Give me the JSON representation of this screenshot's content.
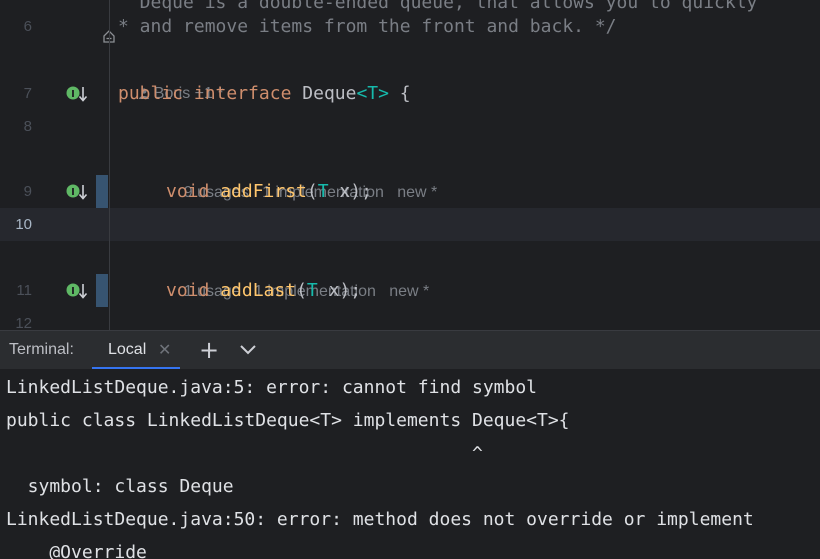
{
  "editor": {
    "lines": [
      {
        "num": "6",
        "text": "* and remove items from the front and back. */"
      },
      {
        "num": "7",
        "kw1": "public",
        "kw2": "interface",
        "name": "Deque",
        "generic": "<T>",
        "rest": " {"
      },
      {
        "num": "8"
      },
      {
        "num": "9",
        "kw": "void",
        "method": "addFirst",
        "open": "(",
        "type": "T",
        "arg": " x",
        "close": ");"
      },
      {
        "num": "10"
      },
      {
        "num": "11",
        "kw": "void",
        "method": "addLast",
        "open": "(",
        "type": "T",
        "arg": " x",
        "close": ");"
      },
      {
        "num": "12"
      }
    ],
    "top_partial": "  Deque is a double-ended queue, that allows you to quickly",
    "author_hint": "Boris +1 *",
    "hint_add_first": {
      "usages": "9 usages",
      "impl": "1 implementation",
      "new": "new *"
    },
    "hint_add_last": {
      "usages": "1 usage",
      "impl": "1 implementation",
      "new": "new *"
    }
  },
  "terminal": {
    "title": "Terminal:",
    "tab_label": "Local",
    "close_glyph": "✕",
    "add_glyph": "+",
    "output": [
      "LinkedListDeque.java:5: error: cannot find symbol",
      "public class LinkedListDeque<T> implements Deque<T>{",
      "                                           ^",
      "  symbol: class Deque",
      "LinkedListDeque.java:50: error: method does not override or implement",
      "    @Override"
    ]
  },
  "icons": {
    "impl": "implemented-interface-icon",
    "fold": "fold-icon",
    "user": "user-icon",
    "chevron": "chevron-down-icon"
  },
  "colors": {
    "background": "#1e1f22",
    "keyword": "#cf8e6d",
    "method": "#ffc66d",
    "accent": "#3574f0",
    "impl_icon": "#5fb865"
  }
}
